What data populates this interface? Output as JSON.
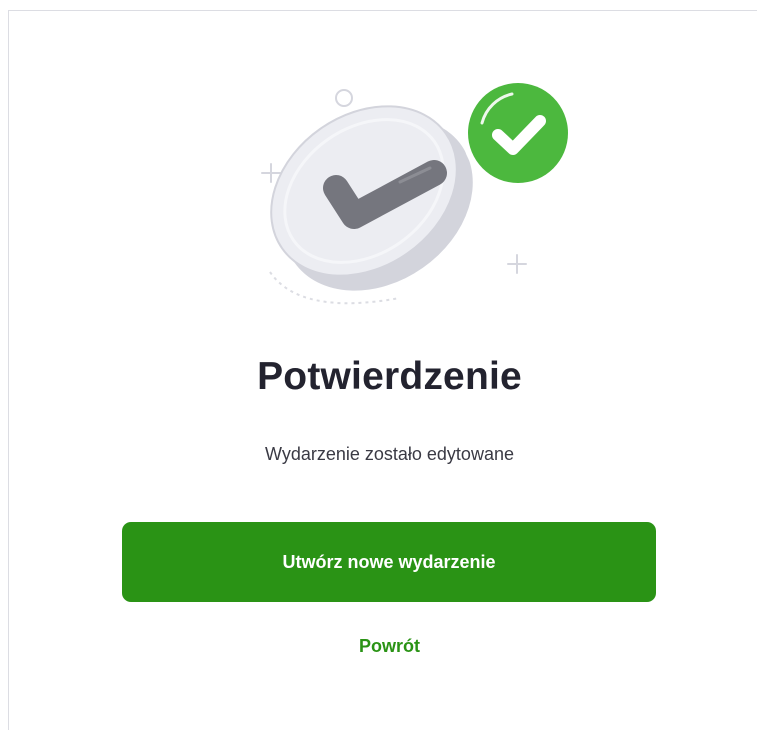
{
  "confirmation": {
    "title": "Potwierdzenie",
    "message": "Wydarzenie zostało edytowane",
    "primary_button_label": "Utwórz nowe wydarzenie",
    "back_link_label": "Powrót"
  },
  "illustration": {
    "icon": "success-check-coin-icon",
    "badge_icon": "green-check-badge-icon"
  },
  "colors": {
    "accent_green": "#2a9315",
    "badge_green": "#4cb83e",
    "title_text": "#23232f",
    "body_text": "#3a3a44"
  }
}
